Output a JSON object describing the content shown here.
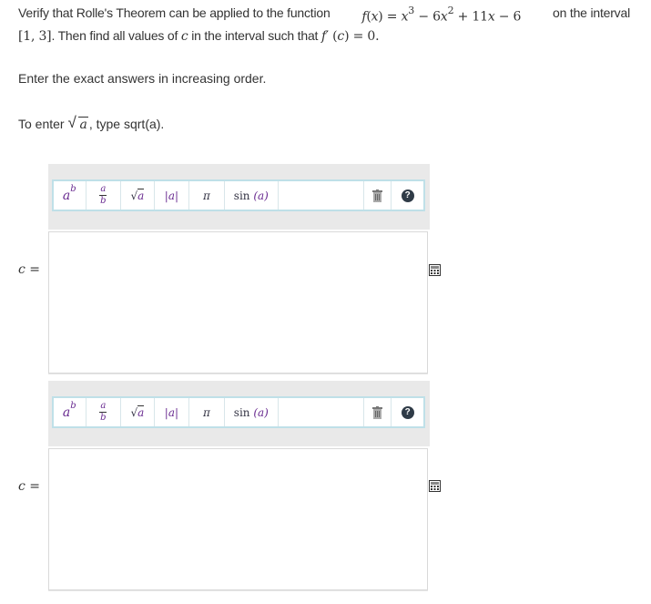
{
  "problem": {
    "line1_part1": "Verify that Rolle's Theorem can be applied to the function",
    "function_math": "f(x) = x³ − 6x² + 11x − 6",
    "line1_part2": "on the interval",
    "interval_math": "[1, 3]",
    "line2_text": ". Then find all values of",
    "line2_text2": "in the interval such that",
    "condition_math": "f′(c) = 0."
  },
  "instruction": "Enter the exact answers in increasing order.",
  "hint": {
    "prefix": "To enter",
    "radicand": "a",
    "suffix": ", type sqrt(a)."
  },
  "toolbar": {
    "power_base": "a",
    "power_exp": "b",
    "fraction_num": "a",
    "fraction_den": "b",
    "sqrt_radicand": "a",
    "abs_label": "|a|",
    "pi_label": "π",
    "sin_label": "sin",
    "sin_arg": "(a)",
    "help_label": "?"
  },
  "answers": [
    {
      "label_var": "c",
      "label_eq": "=",
      "value": ""
    },
    {
      "label_var": "c",
      "label_eq": "=",
      "value": ""
    }
  ],
  "icons": {
    "trash": "trash-icon",
    "help": "help-icon",
    "keypad": "keypad-icon"
  }
}
